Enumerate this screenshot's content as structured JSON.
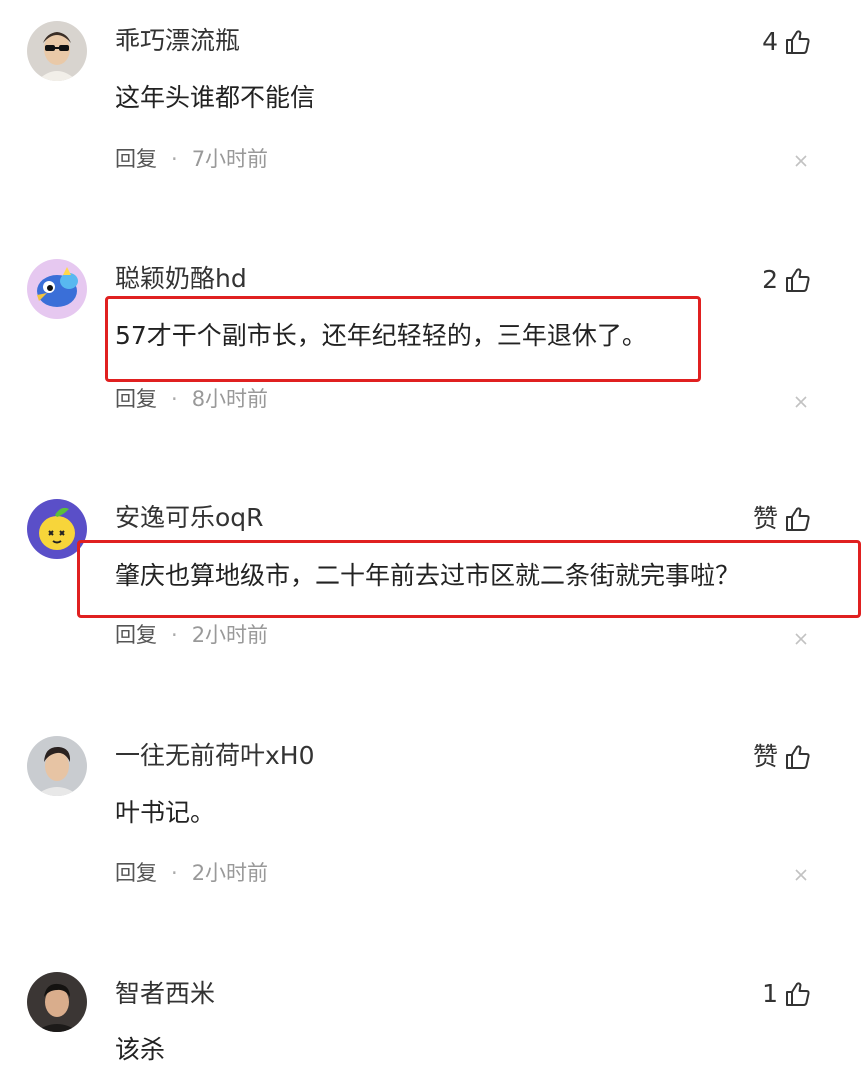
{
  "comments": [
    {
      "username": "乖巧漂流瓶",
      "text": "这年头谁都不能信",
      "likes": "4",
      "reply_label": "回复",
      "separator": "·",
      "time": "7小时前",
      "avatar_icon": "person-sunglasses-avatar",
      "highlighted": false
    },
    {
      "username": "聪颖奶酪hd",
      "text": "57才干个副市长，还年纪轻轻的，三年退休了。",
      "likes": "2",
      "reply_label": "回复",
      "separator": "·",
      "time": "8小时前",
      "avatar_icon": "cartoon-bird-avatar",
      "highlighted": true
    },
    {
      "username": "安逸可乐oqR",
      "text": "肇庆也算地级市，二十年前去过市区就二条街就完事啦？",
      "likes": "赞",
      "reply_label": "回复",
      "separator": "·",
      "time": "2小时前",
      "avatar_icon": "cartoon-lemon-avatar",
      "highlighted": true
    },
    {
      "username": "一往无前荷叶xH0",
      "text": "叶书记。",
      "likes": "赞",
      "reply_label": "回复",
      "separator": "·",
      "time": "2小时前",
      "avatar_icon": "person-photo-avatar",
      "highlighted": false
    },
    {
      "username": "智者西米",
      "text": "该杀",
      "likes": "1",
      "avatar_icon": "person-dark-avatar",
      "highlighted": false
    }
  ],
  "colors": {
    "highlight_border": "#e02020",
    "username": "#333333",
    "meta": "#8a8a8a"
  },
  "icons": {
    "like": "thumbs-up-icon",
    "close": "close-icon"
  }
}
